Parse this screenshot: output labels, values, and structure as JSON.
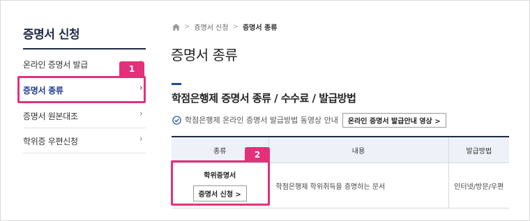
{
  "sidebar": {
    "title": "증명서 신청",
    "items": [
      {
        "label": "온라인 증명서 발급"
      },
      {
        "label": "증명서 종류"
      },
      {
        "label": "증명서 원본대조"
      },
      {
        "label": "학위증 우편신청"
      }
    ]
  },
  "breadcrumb": {
    "items": [
      "증명서 신청",
      "증명서 종류"
    ]
  },
  "page": {
    "title": "증명서 종류",
    "section_title": "학점은행제 증명서 종류 / 수수료 / 발급방법",
    "video_text": "학점은행제 온라인 증명서 발급방법 동영상 안내",
    "video_button": "온라인 증명서 발급안내 영상 >"
  },
  "table": {
    "headers": [
      "종류",
      "내용",
      "발급방법"
    ],
    "rows": [
      {
        "doc_name": "학위증명서",
        "apply_button": "증명서 신청 >",
        "description": "학점은행제 학위취득을 증명하는 문서",
        "method": "인터넷/방문/우편"
      }
    ]
  },
  "annotations": {
    "badge1": "1",
    "badge2": "2"
  },
  "colors": {
    "highlight": "#e4307b",
    "navy": "#1f2a44",
    "table_header_bg": "#eef1f7"
  }
}
